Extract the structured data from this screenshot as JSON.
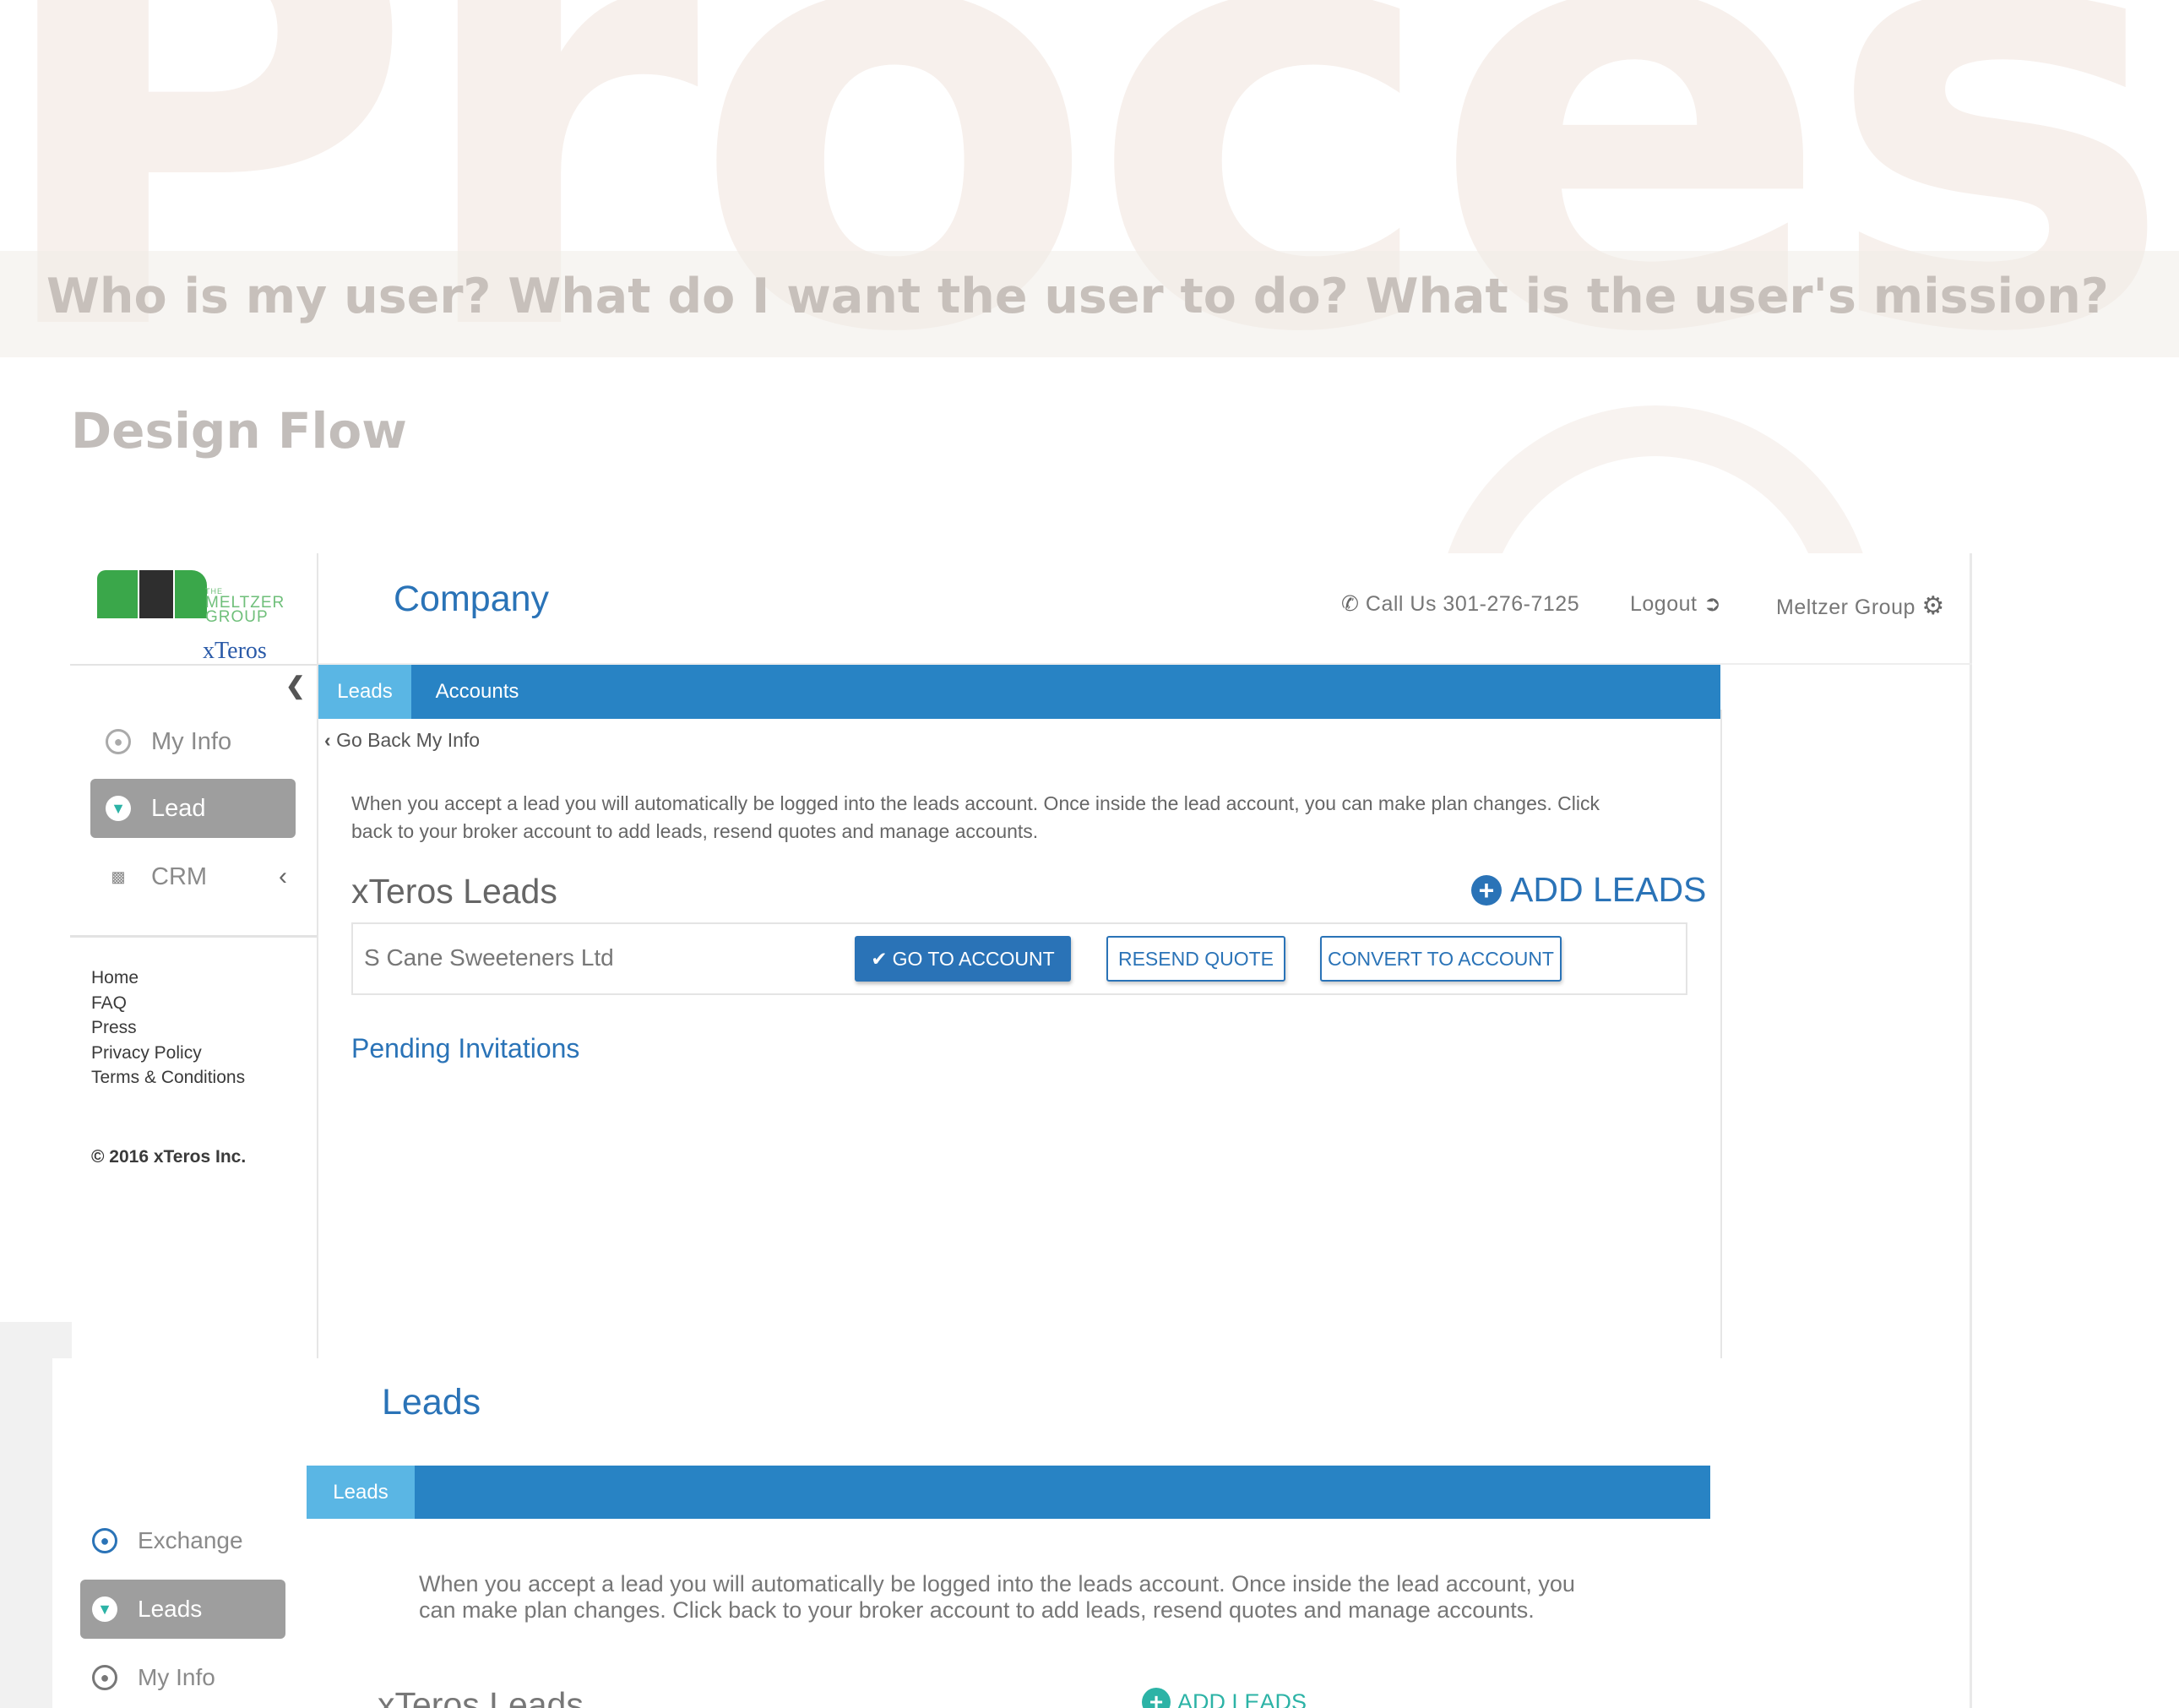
{
  "backdrop": {
    "big_word": "Process",
    "questions": "Who is my user?  What do I want the user to do?  What is the user's mission?",
    "section_title": "Design Flow"
  },
  "mockup1": {
    "logo": {
      "text_line1": "THE",
      "text_line2": "MELTZER",
      "text_line3": "GROUP",
      "powered": "xTeros"
    },
    "page_title": "Company",
    "header": {
      "phone": "Call Us 301-276-7125",
      "logout": "Logout",
      "account": "Meltzer Group"
    },
    "sidebar": {
      "items": [
        {
          "label": "My Info",
          "icon": "user-circle-icon",
          "active": false
        },
        {
          "label": "Lead",
          "icon": "funnel-icon",
          "active": true
        },
        {
          "label": "CRM",
          "icon": "bar-chart-icon",
          "active": false
        }
      ],
      "links": [
        "Home",
        "FAQ",
        "Press",
        "Privacy Policy",
        "Terms & Conditions"
      ],
      "copyright": "© 2016 xTeros Inc."
    },
    "tabs": [
      {
        "label": "Leads",
        "active": true
      },
      {
        "label": "Accounts",
        "active": false
      }
    ],
    "go_back": "Go Back My Info",
    "intro_line1": "When you accept a lead you will automatically be logged into the leads account. Once inside the lead account, you can make plan changes. Click",
    "intro_line2": "back to your broker account to add leads, resend quotes and manage accounts.",
    "section_title": "xTeros Leads",
    "add_leads": "ADD LEADS",
    "lead_row": {
      "name": "S Cane Sweeteners Ltd",
      "go_to_account": "GO TO ACCOUNT",
      "resend_quote": "RESEND QUOTE",
      "convert": "CONVERT TO ACCOUNT"
    },
    "pending": "Pending Invitations"
  },
  "mockup2": {
    "page_title": "Leads",
    "tabs": [
      {
        "label": "Leads",
        "active": true
      }
    ],
    "sidebar": {
      "items": [
        {
          "label": "Exchange",
          "icon": "globe-icon",
          "active": false
        },
        {
          "label": "Leads",
          "icon": "funnel-icon",
          "active": true
        },
        {
          "label": "My Info",
          "icon": "user-circle-icon",
          "active": false
        }
      ]
    },
    "intro_line1": "When you accept a lead you will automatically be logged into the leads account.  Once inside the lead account, you",
    "intro_line2": "can make plan changes.  Click back to your broker account to add leads, resend quotes and manage accounts.",
    "section_title": "xTeros Leads",
    "add_leads": "ADD LEADS"
  },
  "colors": {
    "primary_blue": "#2883c4",
    "tab_active": "#5ab6e4",
    "link_blue": "#2a73b7",
    "sidebar_active": "#9e9e9e",
    "logo_green": "#3aa74a",
    "teal": "#2cb3a6"
  }
}
